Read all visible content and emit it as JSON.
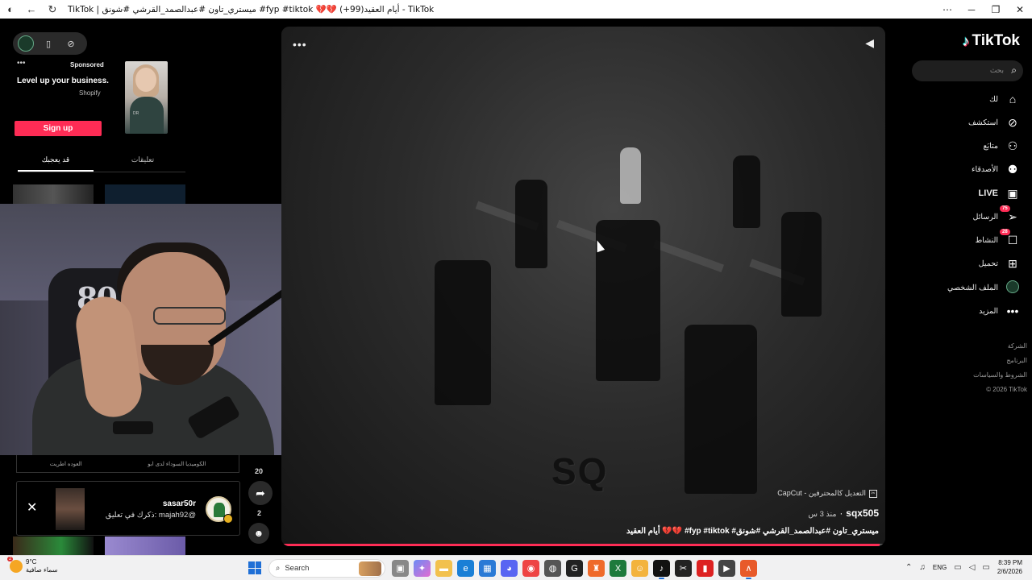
{
  "window": {
    "title": "TikTok | ميستري_تاون #عبدالصمد_القرشي #شونق #fyp #tiktok 💔💔 أيام العقيد(99+) - TikTok",
    "controls": {
      "more": "⋯",
      "minimize": "─",
      "restore": "❐",
      "close": "✕"
    }
  },
  "left": {
    "ad": {
      "sponsored": "Sponsored",
      "headline": "Level up your business.",
      "brand": "Shopify",
      "cta": "Sign up",
      "thumb_label": "DR"
    },
    "tabs": {
      "active": "قد يعجبك",
      "inactive": "تعليقات"
    },
    "partial_row": {
      "left": "العوده اطريت",
      "right": "الكوميديا السوداء لدى ابو"
    },
    "notification": {
      "username": "sasar50r",
      "message": "ذكرك في تعليق: majah92@"
    },
    "counts": {
      "above_share": "20",
      "shares": "2"
    }
  },
  "webcam": {
    "chair_text": "80"
  },
  "video": {
    "watermark": "SQ",
    "capcut": "CapCut - التعديل كالمحترفين",
    "author": "sqx505",
    "posted": "منذ 3 س",
    "caption": "أيام العقيد 💔💔 #fyp #tiktok #ميستري_تاون #عبدالصمد_القرشي #شونق",
    "progress": 0.99
  },
  "sidebar": {
    "brand": "TikTok",
    "search_placeholder": "بحث",
    "nav": [
      {
        "label": "لك",
        "icon": "home-icon"
      },
      {
        "label": "استكشف",
        "icon": "compass-icon"
      },
      {
        "label": "متابَع",
        "icon": "user-follow-icon"
      },
      {
        "label": "الأصدقاء",
        "icon": "friends-icon"
      },
      {
        "label": "LIVE",
        "icon": "live-icon"
      },
      {
        "label": "الرسائل",
        "icon": "messages-icon",
        "badge": "75"
      },
      {
        "label": "النشاط",
        "icon": "activity-icon",
        "badge": "28"
      },
      {
        "label": "تحميل",
        "icon": "upload-icon"
      },
      {
        "label": "الملف الشخصي",
        "icon": "profile-avatar"
      },
      {
        "label": "المزيد",
        "icon": "more-icon"
      }
    ],
    "footer": [
      "الشركة",
      "البرنامج",
      "الشروط والسياسات",
      "© 2026 TikTok"
    ]
  },
  "taskbar": {
    "weather_temp": "9°C",
    "weather_desc": "سماء صافية",
    "weather_badge": "2",
    "search_label": "Search",
    "lang": "ENG",
    "time": "8:39 PM",
    "date": "2/6/2026"
  },
  "colors": {
    "accent": "#fe2c55",
    "background": "#000000",
    "taskbar": "#f1f1f2"
  }
}
